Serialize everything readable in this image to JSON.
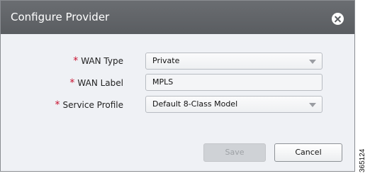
{
  "dialog": {
    "title": "Configure Provider",
    "close_icon": "close-icon"
  },
  "form": {
    "required_marker": "*",
    "wan_type": {
      "label": "WAN Type",
      "value": "Private"
    },
    "wan_label": {
      "label": "WAN Label",
      "value": "MPLS"
    },
    "service_profile": {
      "label": "Service Profile",
      "value": "Default 8-Class Model"
    }
  },
  "buttons": {
    "save": "Save",
    "cancel": "Cancel"
  },
  "figure_number": "365124",
  "colors": {
    "titlebar": "#5f6266",
    "dialog_bg": "#eff1f5",
    "required": "#c8102e"
  }
}
